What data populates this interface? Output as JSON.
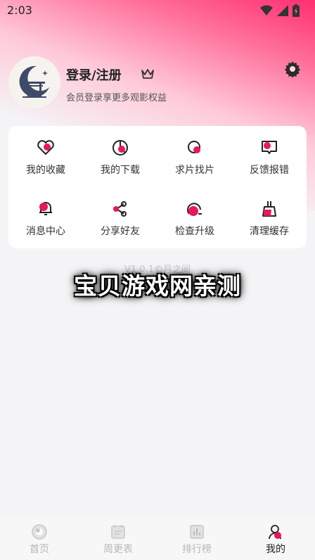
{
  "status": {
    "time": "2:03"
  },
  "profile": {
    "title": "登录/注册",
    "subtitle": "会员登录享更多观影权益"
  },
  "menu": [
    {
      "label": "我的收藏",
      "icon": "heart-icon"
    },
    {
      "label": "我的下载",
      "icon": "download-icon"
    },
    {
      "label": "求片找片",
      "icon": "search-movie-icon"
    },
    {
      "label": "反馈报错",
      "icon": "feedback-icon"
    },
    {
      "label": "消息中心",
      "icon": "bell-icon"
    },
    {
      "label": "分享好友",
      "icon": "share-icon"
    },
    {
      "label": "检查升级",
      "icon": "upgrade-icon"
    },
    {
      "label": "清理缓存",
      "icon": "broom-icon"
    }
  ],
  "version_text": "V1.0.1©月之间",
  "watermark": "宝贝游戏网亲测",
  "tabs": [
    {
      "label": "首页",
      "icon": "home-icon"
    },
    {
      "label": "周更表",
      "icon": "calendar-icon"
    },
    {
      "label": "排行榜",
      "icon": "ranking-icon"
    },
    {
      "label": "我的",
      "icon": "profile-icon",
      "active": true
    }
  ],
  "colors": {
    "accent": "#e8175d",
    "brand_gradient_top": "#ff2f6f"
  }
}
